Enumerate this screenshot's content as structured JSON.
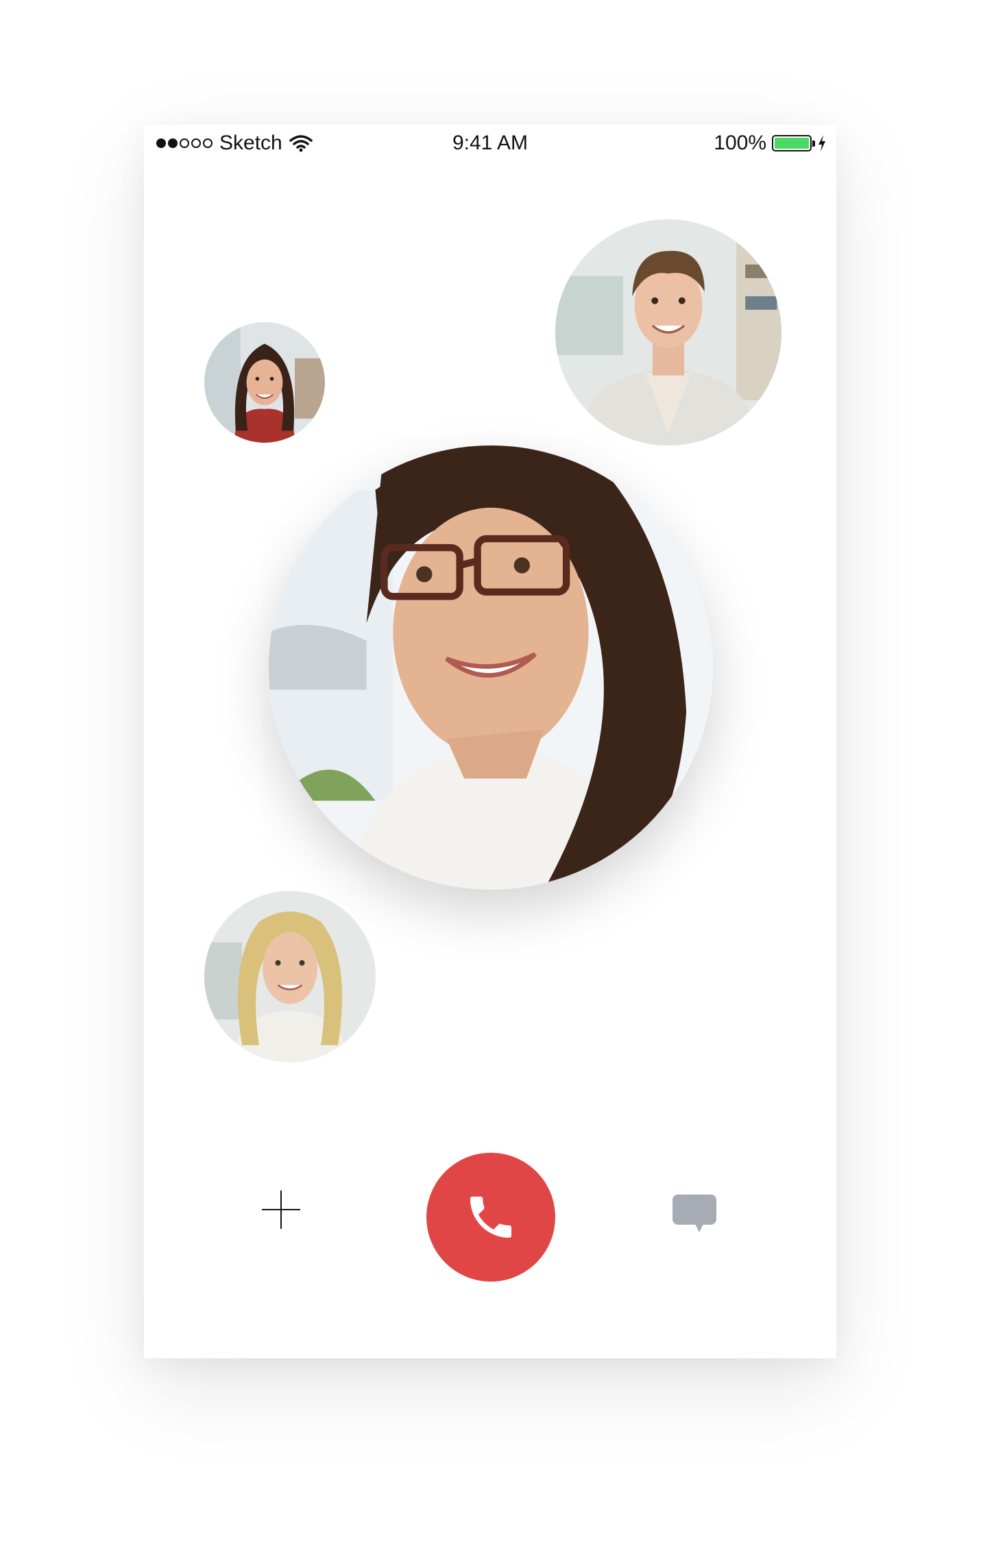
{
  "status_bar": {
    "carrier": "Sketch",
    "time": "9:41 AM",
    "battery_percent": "100%",
    "battery_level": 1.0,
    "signal_bars_filled": 2,
    "signal_bars_total": 5
  },
  "participants": [
    {
      "name": "participant-top-left",
      "icon": "woman-avatar"
    },
    {
      "name": "participant-top-right",
      "icon": "man-avatar"
    },
    {
      "name": "participant-main",
      "icon": "woman-glasses-avatar"
    },
    {
      "name": "participant-bottom-left",
      "icon": "blonde-woman-avatar"
    }
  ],
  "controls": {
    "add_icon": "plus-icon",
    "end_call_icon": "phone-icon",
    "chat_icon": "chat-bubble-icon"
  },
  "colors": {
    "end_call": "#e04646",
    "battery": "#4cd964",
    "chat_icon": "#a7abb3"
  }
}
